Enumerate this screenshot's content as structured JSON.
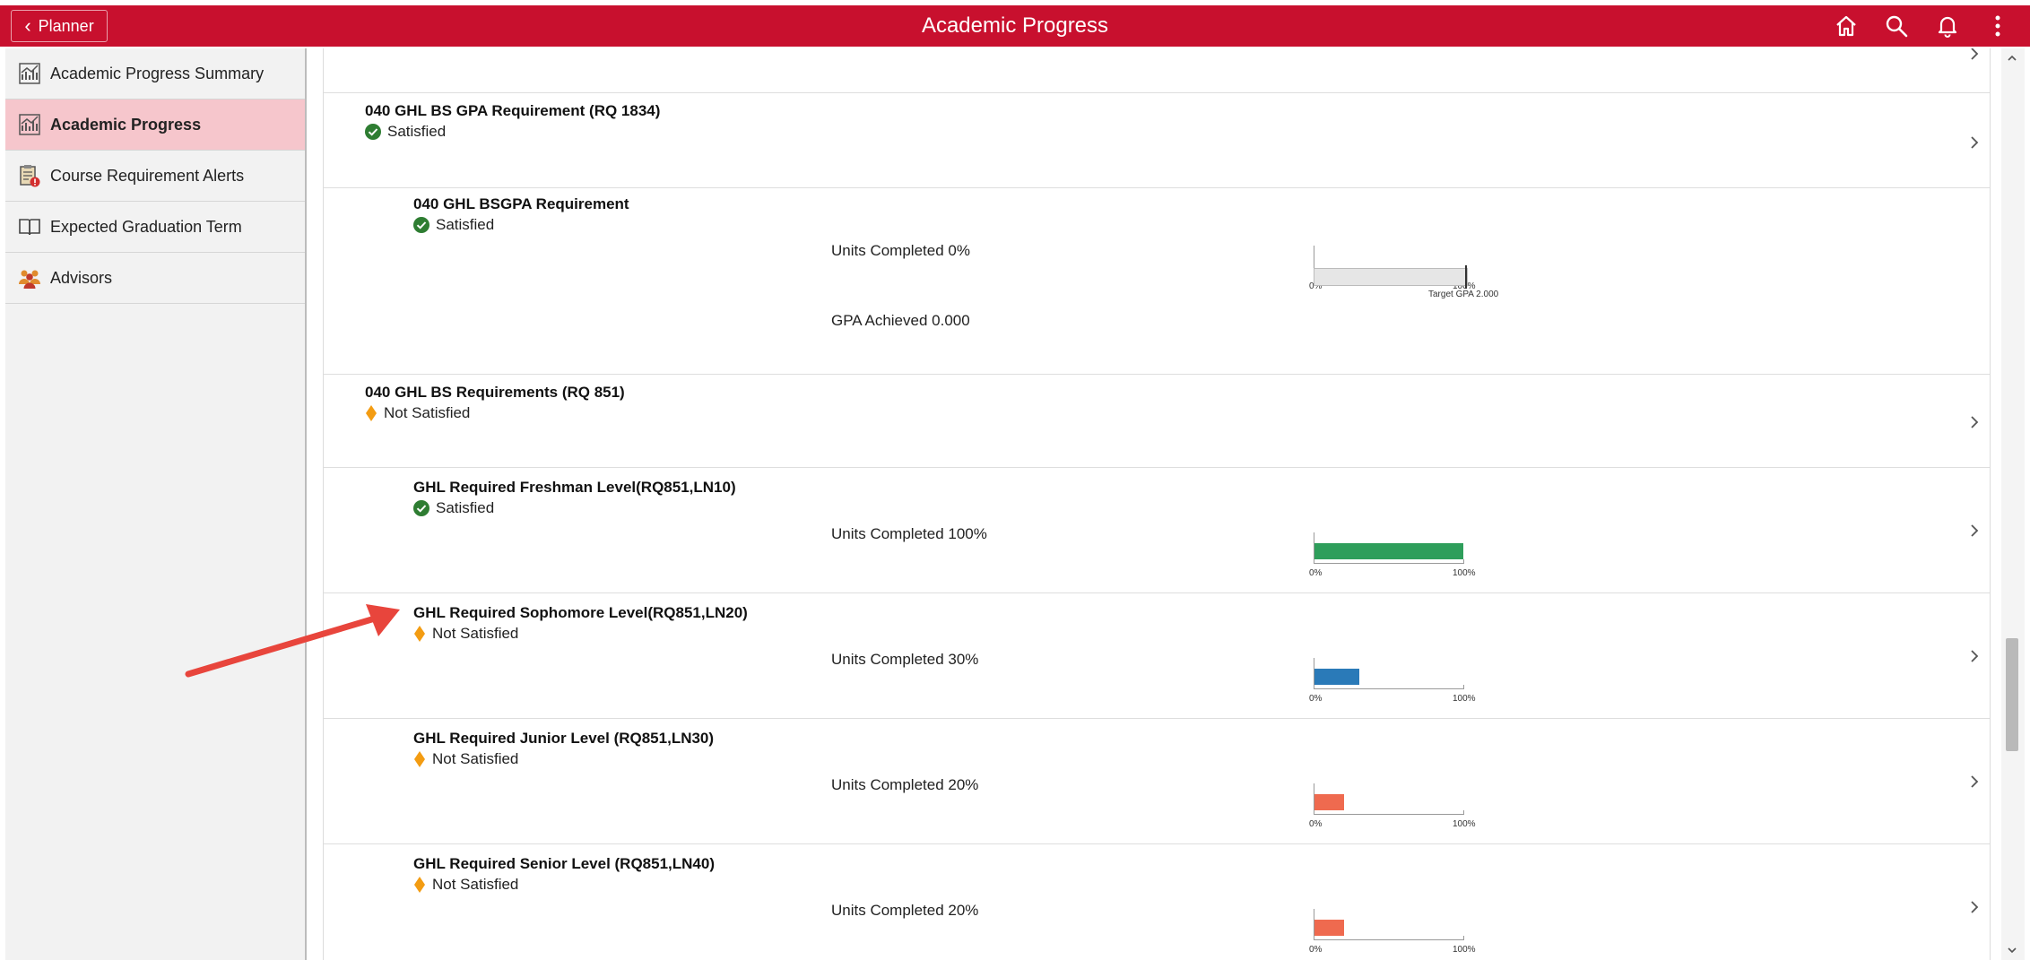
{
  "header": {
    "back_label": "Planner",
    "title": "Academic Progress",
    "icons": [
      "home-icon",
      "search-icon",
      "bell-icon",
      "more-vertical-icon"
    ],
    "bg_color": "#c8102e"
  },
  "sidebar": {
    "items": [
      {
        "label": "Academic Progress Summary",
        "icon": "chart-icon"
      },
      {
        "label": "Academic Progress",
        "icon": "chart-icon",
        "active": true
      },
      {
        "label": "Course Requirement Alerts",
        "icon": "alert-clipboard-icon"
      },
      {
        "label": "Expected Graduation Term",
        "icon": "book-icon"
      },
      {
        "label": "Advisors",
        "icon": "people-icon"
      }
    ],
    "active_color": "#f6c6cc"
  },
  "requirements": {
    "gpa_req": {
      "title": "040 GHL BS GPA Requirement (RQ 1834)",
      "status": "Satisfied"
    },
    "bsgpa": {
      "title": "040 GHL BSGPA Requirement",
      "status": "Satisfied",
      "units_label": "Units Completed 0%",
      "units_progress": 0,
      "gpa_label": "GPA Achieved  0.000",
      "gpa_target_label": "Target GPA 2.000",
      "tick_min": "0%",
      "tick_max": "100%"
    },
    "bs_req": {
      "title": "040 GHL BS Requirements (RQ 851)",
      "status": "Not Satisfied"
    },
    "freshman": {
      "title": "GHL Required Freshman Level(RQ851,LN10)",
      "status": "Satisfied",
      "units_label": "Units Completed 100%",
      "progress": 100,
      "bar_color": "#2e9e5b",
      "tick_min": "0%",
      "tick_max": "100%"
    },
    "sophomore": {
      "title": "GHL Required Sophomore Level(RQ851,LN20)",
      "status": "Not Satisfied",
      "units_label": "Units Completed 30%",
      "progress": 30,
      "bar_color": "#2a7ab8",
      "tick_min": "0%",
      "tick_max": "100%"
    },
    "junior": {
      "title": "GHL Required Junior Level (RQ851,LN30)",
      "status": "Not Satisfied",
      "units_label": "Units Completed 20%",
      "progress": 20,
      "bar_color": "#ef6a4f",
      "tick_min": "0%",
      "tick_max": "100%"
    },
    "senior": {
      "title": "GHL Required Senior Level (RQ851,LN40)",
      "status": "Not Satisfied",
      "units_label": "Units Completed 20%",
      "progress": 20,
      "bar_color": "#ef6a4f",
      "tick_min": "0%",
      "tick_max": "100%"
    }
  },
  "colors": {
    "satisfied": "#2e7d32",
    "not_satisfied": "#f39c12",
    "annotation_arrow": "#e8453c"
  }
}
